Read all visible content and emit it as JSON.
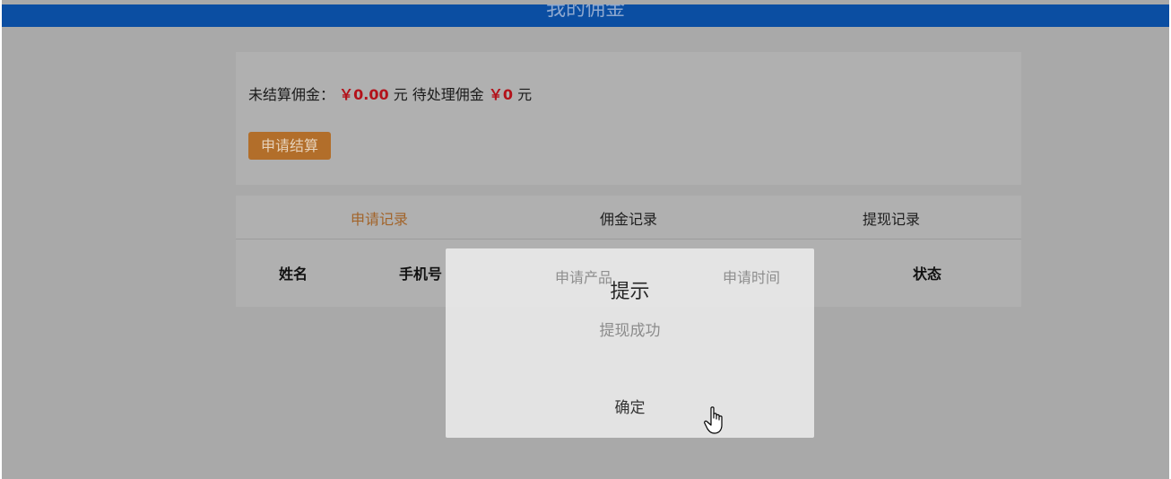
{
  "header": {
    "title": "我的佣金"
  },
  "summary": {
    "unsettled_label": "未结算佣金：",
    "unsettled_amount": "￥0.00",
    "unsettled_unit": "元",
    "pending_label": "待处理佣金",
    "pending_amount": "￥0",
    "pending_unit": "元",
    "apply_button": "申请结算"
  },
  "tabs": [
    {
      "label": "申请记录",
      "active": true
    },
    {
      "label": "佣金记录",
      "active": false
    },
    {
      "label": "提现记录",
      "active": false
    }
  ],
  "table": {
    "columns": [
      "姓名",
      "手机号",
      "申请产品",
      "申请时间",
      "状态"
    ]
  },
  "dialog": {
    "title": "提示",
    "message": "提现成功",
    "confirm": "确定"
  },
  "colors": {
    "header_bg": "#0b4ea2",
    "accent_orange": "#b26e2a",
    "money_red": "#b3121a"
  }
}
